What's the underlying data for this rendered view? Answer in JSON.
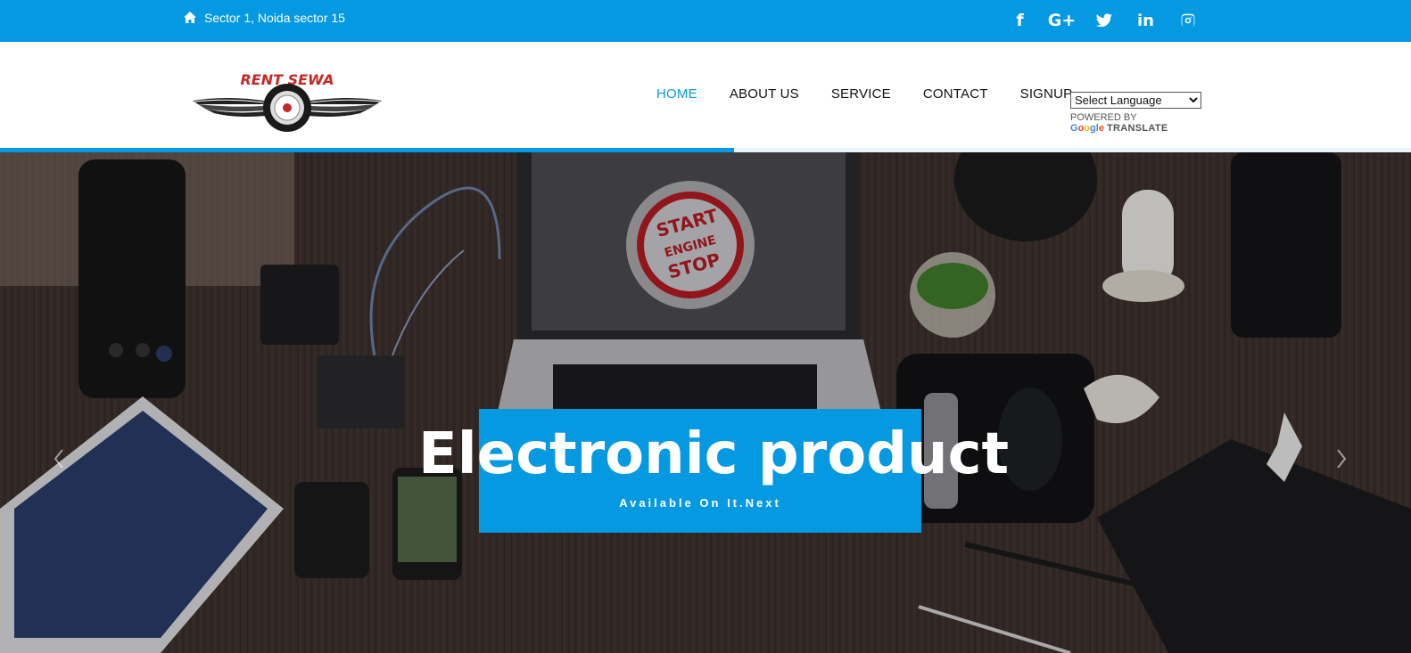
{
  "topbar": {
    "address": "Sector 1, Noida sector 15",
    "social": [
      {
        "icon": "facebook-icon",
        "glyph": "f"
      },
      {
        "icon": "google-plus-icon",
        "glyph": "G+"
      },
      {
        "icon": "twitter-icon",
        "glyph": ""
      },
      {
        "icon": "linkedin-icon",
        "glyph": "in"
      },
      {
        "icon": "instagram-icon",
        "glyph": ""
      }
    ]
  },
  "header": {
    "logo_text": "RENT SEWA",
    "nav": [
      {
        "label": "HOME",
        "active": true
      },
      {
        "label": "ABOUT US",
        "active": false
      },
      {
        "label": "SERVICE",
        "active": false
      },
      {
        "label": "CONTACT",
        "active": false
      },
      {
        "label": "SIGNUP",
        "active": false
      }
    ],
    "translate": {
      "select_value": "Select Language",
      "powered_by": "POWERED BY",
      "google": "Google",
      "translate_label": "TRANSLATE"
    }
  },
  "slider": {
    "progress": 0.52,
    "title": "Electronic product",
    "subtitle": "Available On It.Next",
    "screen_text": [
      "START",
      "ENGINE",
      "STOP"
    ]
  },
  "colors": {
    "accent": "#0499e1",
    "nav_text": "#111111",
    "logo_red": "#c62828"
  }
}
